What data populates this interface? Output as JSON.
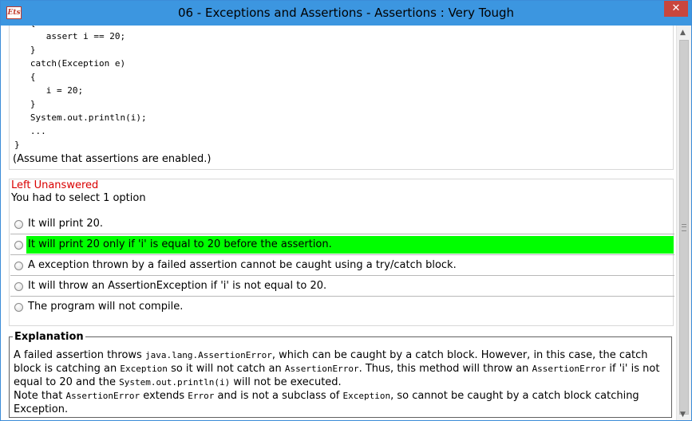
{
  "window": {
    "title": "06 - Exceptions and Assertions - Assertions  :  Very Tough",
    "app_icon_text": "Ets",
    "close_symbol": "✕"
  },
  "code": {
    "lines": "   {\n      assert i == 20;\n   }\n   catch(Exception e)\n   {\n      i = 20;\n   }\n   System.out.println(i);\n   ...\n}",
    "assume_note": "(Assume that assertions are enabled.)"
  },
  "question": {
    "status": "Left Unanswered",
    "select_note": "You had to select 1 option",
    "options": [
      {
        "label": "It will print 20."
      },
      {
        "label": "It will print 20 only if 'i' is equal to 20 before the assertion."
      },
      {
        "label": "A exception thrown by a failed assertion cannot be caught using a try/catch block."
      },
      {
        "label": "It will throw an AssertionException if 'i' is not equal to 20."
      },
      {
        "label": "The program will not compile."
      }
    ]
  },
  "explanation": {
    "legend": "Explanation",
    "p1": [
      "A failed assertion throws ",
      "java.lang.AssertionError",
      ", which can be caught by a catch block. However, in this case, the catch block is catching an ",
      "Exception",
      " so it will not catch an ",
      "AssertionError",
      ". Thus, this method will throw an ",
      "AssertionError",
      " if 'i' is not equal to 20 and the ",
      "System.out.println(i)",
      " will not be executed."
    ],
    "p2": [
      "Note that ",
      "AssertionError",
      " extends ",
      "Error",
      " and is not a subclass of ",
      "Exception",
      ", so cannot be caught by a catch block catching Exception."
    ]
  },
  "colors": {
    "titlebar": "#3c96e0",
    "correct_highlight": "#00ff00",
    "status_red": "#d90000",
    "close_red": "#c9463d"
  }
}
